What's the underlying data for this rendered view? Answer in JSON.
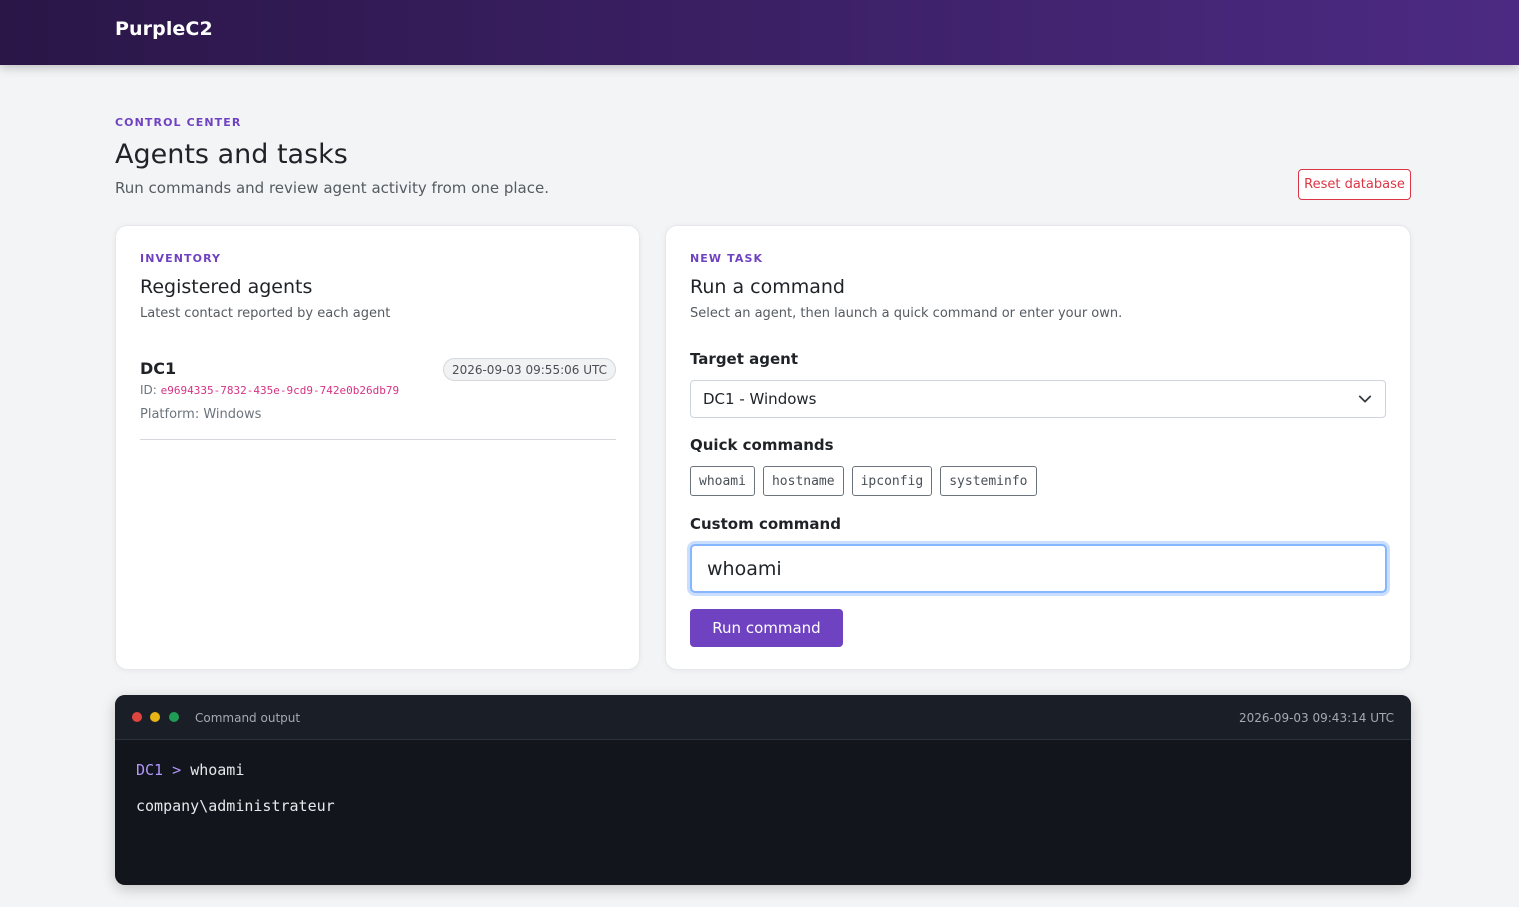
{
  "app": {
    "brand": "PurpleC2"
  },
  "page": {
    "eyebrow": "CONTROL CENTER",
    "title": "Agents and tasks",
    "subtitle": "Run commands and review agent activity from one place.",
    "reset_label": "Reset database"
  },
  "inventory": {
    "eyebrow": "INVENTORY",
    "title": "Registered agents",
    "subtitle": "Latest contact reported by each agent",
    "agents": [
      {
        "name": "DC1",
        "last_seen": "2026-09-03 09:55:06 UTC",
        "id_label": "ID:",
        "id": "e9694335-7832-435e-9cd9-742e0b26db79",
        "platform": "Platform: Windows"
      }
    ]
  },
  "task": {
    "eyebrow": "NEW TASK",
    "title": "Run a command",
    "subtitle": "Select an agent, then launch a quick command or enter your own.",
    "target_label": "Target agent",
    "target_value": "DC1 - Windows",
    "quick_label": "Quick commands",
    "quick_commands": [
      "whoami",
      "hostname",
      "ipconfig",
      "systeminfo"
    ],
    "custom_label": "Custom command",
    "custom_value": "whoami",
    "run_label": "Run command"
  },
  "output": {
    "title": "Command output",
    "timestamp": "2026-09-03 09:43:14 UTC",
    "agent": "DC1",
    "separator": ">",
    "command": "whoami",
    "result": "company\\administrateur"
  },
  "colors": {
    "accent": "#6f42c1",
    "danger": "#dc3545",
    "terminal_bg": "#12151b"
  }
}
